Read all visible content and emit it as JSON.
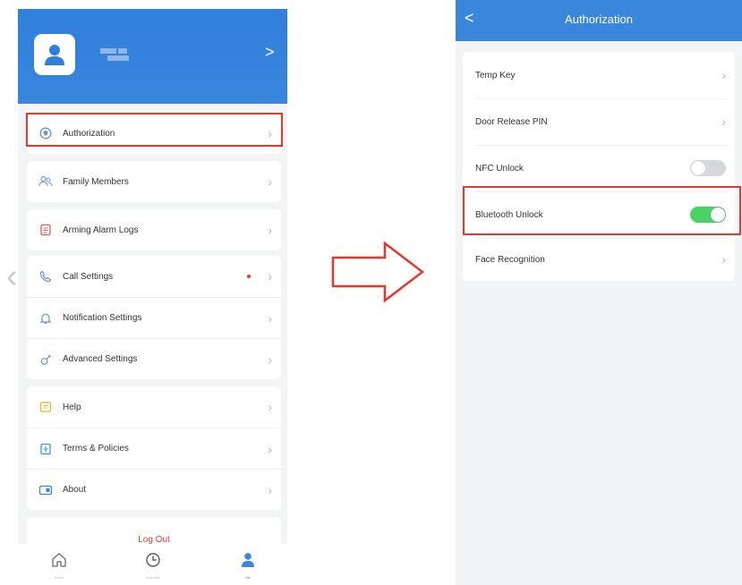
{
  "colors": {
    "brand": "#3a86dd",
    "highlight": "#e8372f",
    "toggle_on": "#4cd264",
    "toggle_off": "#d6d8dc",
    "logout": "#e8372f"
  },
  "left_screen": {
    "header": {
      "avatar_icon": "user-avatar-icon",
      "chevron": ">"
    },
    "groups": [
      {
        "items": [
          {
            "label": "Authorization",
            "icon": "shield-icon"
          }
        ]
      },
      {
        "items": [
          {
            "label": "Family Members",
            "icon": "family-icon"
          }
        ]
      },
      {
        "items": [
          {
            "label": "Arming Alarm Logs",
            "icon": "alarm-log-icon"
          }
        ]
      },
      {
        "items": [
          {
            "label": "Call Settings",
            "icon": "phone-icon",
            "has_dot": true
          },
          {
            "label": "Notification Settings",
            "icon": "bell-icon"
          },
          {
            "label": "Advanced Settings",
            "icon": "settings-icon"
          }
        ]
      },
      {
        "items": [
          {
            "label": "Help",
            "icon": "help-icon"
          },
          {
            "label": "Terms & Policies",
            "icon": "document-icon"
          },
          {
            "label": "About",
            "icon": "info-icon"
          }
        ]
      }
    ],
    "logout_label": "Log Out",
    "tabs": [
      {
        "label": "Home",
        "icon": "home-icon"
      },
      {
        "label": "Activities",
        "icon": "clock-icon"
      },
      {
        "label": "Me",
        "icon": "user-icon",
        "active": true
      }
    ]
  },
  "right_screen": {
    "nav": {
      "back": "<",
      "title": "Authorization"
    },
    "items": [
      {
        "label": "Temp Key",
        "control": "chevron"
      },
      {
        "label": "Door Release PIN",
        "control": "chevron"
      },
      {
        "label": "NFC Unlock",
        "control": "toggle",
        "toggle_on": false
      },
      {
        "label": "Bluetooth Unlock",
        "control": "toggle",
        "toggle_on": true
      },
      {
        "label": "Face Recognition",
        "control": "chevron"
      }
    ]
  }
}
